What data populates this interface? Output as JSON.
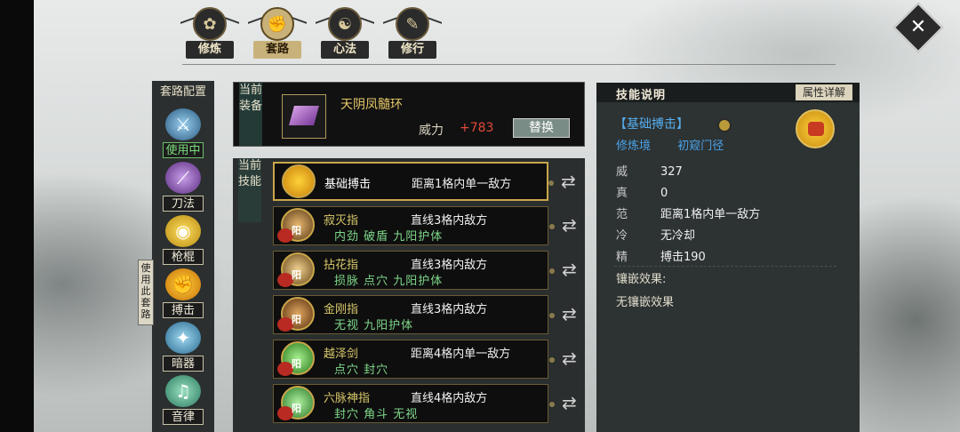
{
  "nav": {
    "tabs": [
      {
        "label": "修炼",
        "icon": "lotus-emblem-icon"
      },
      {
        "label": "套路",
        "icon": "fist-emblem-icon",
        "active": true
      },
      {
        "label": "心法",
        "icon": "swirl-emblem-icon"
      },
      {
        "label": "修行",
        "icon": "scroll-emblem-icon"
      }
    ]
  },
  "sidebar": {
    "title": "套路配置",
    "use_this_route": "使用此套路",
    "items": [
      {
        "label": "使用中",
        "icon": "sword-icon",
        "active": true
      },
      {
        "label": "刀法",
        "icon": "blade-icon"
      },
      {
        "label": "枪棍",
        "icon": "spear-icon"
      },
      {
        "label": "搏击",
        "icon": "fist-icon"
      },
      {
        "label": "暗器",
        "icon": "dart-icon"
      },
      {
        "label": "音律",
        "icon": "music-icon"
      }
    ]
  },
  "equip": {
    "label": "当前装备",
    "name": "天阴凤髓环",
    "power_label": "威力",
    "power_value": "+783",
    "swap_label": "替换"
  },
  "skills": {
    "label": "当前技能",
    "yang": "阳",
    "rows": [
      {
        "name": "基础搏击",
        "range": "距离1格内单一敌方",
        "tags": "",
        "selected": true
      },
      {
        "name": "寂灭指",
        "range": "直线3格内敌方",
        "tags": "内劲 破盾 九阳护体"
      },
      {
        "name": "拈花指",
        "range": "直线3格内敌方",
        "tags": "损脉 点穴 九阳护体"
      },
      {
        "name": "金刚指",
        "range": "直线3格内敌方",
        "tags": "无视 九阳护体"
      },
      {
        "name": "越泽剑",
        "range": "距离4格内单一敌方",
        "tags": "点穴 封穴"
      },
      {
        "name": "六脉神指",
        "range": "直线4格内敌方",
        "tags": "封穴 角斗 无视"
      }
    ]
  },
  "detail": {
    "header": "技能说明",
    "attr_button": "属性详解",
    "skill_name": "【基础搏击】",
    "realm": "修炼境",
    "path": "初窥门径",
    "stats": [
      {
        "key": "威",
        "value": "327"
      },
      {
        "key": "真",
        "value": "0"
      },
      {
        "key": "范",
        "value": "距离1格内单一敌方"
      },
      {
        "key": "冷",
        "value": "无冷却"
      },
      {
        "key": "精",
        "value": "搏击190"
      }
    ],
    "inlay_title": "镶嵌效果:",
    "inlay_value": "无镶嵌效果"
  }
}
